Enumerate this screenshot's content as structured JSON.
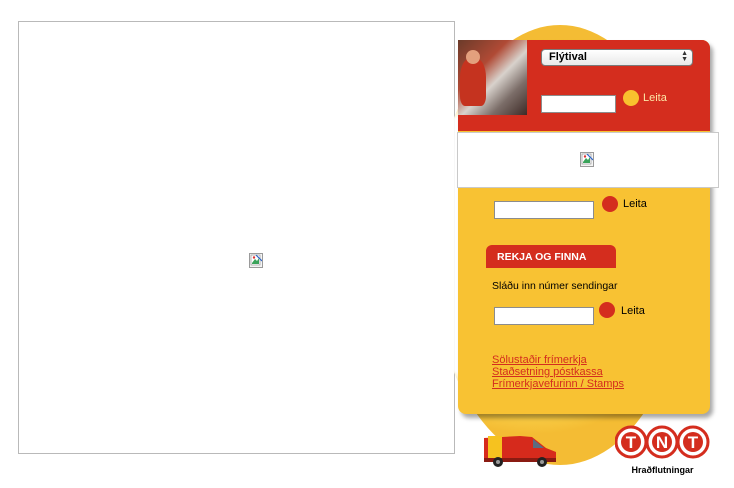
{
  "search": {
    "dropdown_value": "Flýtival",
    "top_input_value": "",
    "top_button_label": "Leita",
    "middle_input_value": "",
    "middle_button_label": "Leita"
  },
  "track": {
    "tab_label": "REKJA OG FINNA",
    "prompt": "Sláðu inn númer sendingar",
    "input_value": "",
    "button_label": "Leita"
  },
  "links": [
    "Sölustaðir frímerkja",
    "Staðsetning póstkassa",
    "Frímerkjavefurinn / Stamps"
  ],
  "logo": {
    "brand": "TNT",
    "tagline": "Hraðflutningar"
  },
  "colors": {
    "red": "#d42d1e",
    "yellow": "#f8c233",
    "orange_dot": "#f9c12e"
  }
}
